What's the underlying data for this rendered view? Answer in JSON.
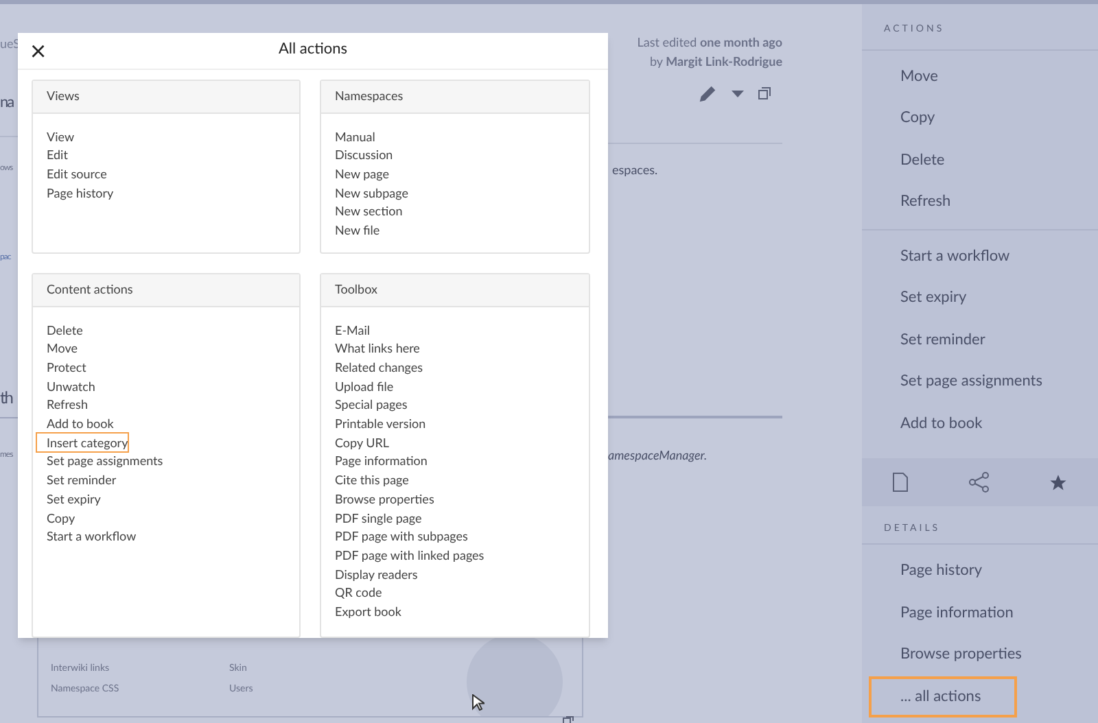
{
  "page": {
    "breadcrumb_fragment": "ueS",
    "title_fragment": "na",
    "text_fragment_1": "ows",
    "link_fragment": "pac",
    "heading_fragment": "th",
    "text_fragment_2": "mes",
    "last_edited": "Last edited **one month ago**",
    "edited_by": "by **Margit Link-Rodrigue**",
    "right_fragment_1": "espaces.",
    "right_fragment_2": "amespaceManager.",
    "table_cells": [
      "Interwiki links",
      "Skin",
      "Namespace CSS",
      "Users"
    ]
  },
  "dialog": {
    "title": "All actions",
    "close": "×",
    "sections": [
      {
        "title": "Views",
        "items": [
          {
            "label": "View",
            "highlighted": false
          },
          {
            "label": "Edit",
            "highlighted": false
          },
          {
            "label": "Edit source",
            "highlighted": false
          },
          {
            "label": "Page history",
            "highlighted": false
          }
        ]
      },
      {
        "title": "Namespaces",
        "items": [
          {
            "label": "Manual",
            "highlighted": false
          },
          {
            "label": "Discussion",
            "highlighted": false
          },
          {
            "label": "New page",
            "highlighted": false
          },
          {
            "label": "New subpage",
            "highlighted": false
          },
          {
            "label": "New section",
            "highlighted": false
          },
          {
            "label": "New file",
            "highlighted": false
          }
        ]
      },
      {
        "title": "Content actions",
        "items": [
          {
            "label": "Delete",
            "highlighted": false
          },
          {
            "label": "Move",
            "highlighted": false
          },
          {
            "label": "Protect",
            "highlighted": false
          },
          {
            "label": "Unwatch",
            "highlighted": false
          },
          {
            "label": "Refresh",
            "highlighted": false
          },
          {
            "label": "Add to book",
            "highlighted": false
          },
          {
            "label": "Insert category",
            "highlighted": true
          },
          {
            "label": "Set page assignments",
            "highlighted": false
          },
          {
            "label": "Set reminder",
            "highlighted": false
          },
          {
            "label": "Set expiry",
            "highlighted": false
          },
          {
            "label": "Copy",
            "highlighted": false
          },
          {
            "label": "Start a workflow",
            "highlighted": false
          }
        ]
      },
      {
        "title": "Toolbox",
        "items": [
          {
            "label": "E-Mail",
            "highlighted": false
          },
          {
            "label": "What links here",
            "highlighted": false
          },
          {
            "label": "Related changes",
            "highlighted": false
          },
          {
            "label": "Upload file",
            "highlighted": false
          },
          {
            "label": "Special pages",
            "highlighted": false
          },
          {
            "label": "Printable version",
            "highlighted": false
          },
          {
            "label": "Copy URL",
            "highlighted": false
          },
          {
            "label": "Page information",
            "highlighted": false
          },
          {
            "label": "Cite this page",
            "highlighted": false
          },
          {
            "label": "Browse properties",
            "highlighted": false
          },
          {
            "label": "PDF single page",
            "highlighted": false
          },
          {
            "label": "PDF page with subpages",
            "highlighted": false
          },
          {
            "label": "PDF page with linked pages",
            "highlighted": false
          },
          {
            "label": "Display readers",
            "highlighted": false
          },
          {
            "label": "QR code",
            "highlighted": false
          },
          {
            "label": "Export book",
            "highlighted": false
          }
        ]
      }
    ]
  },
  "sidebar": {
    "actions_heading": "ACTIONS",
    "action_groups": [
      [
        {
          "label": "Move",
          "highlighted": false
        },
        {
          "label": "Copy",
          "highlighted": false
        },
        {
          "label": "Delete",
          "highlighted": false
        },
        {
          "label": "Refresh",
          "highlighted": false
        }
      ],
      [
        {
          "label": "Start a workflow",
          "highlighted": false
        },
        {
          "label": "Set expiry",
          "highlighted": false
        },
        {
          "label": "Set reminder",
          "highlighted": false
        },
        {
          "label": "Set page assignments",
          "highlighted": false
        },
        {
          "label": "Add to book",
          "highlighted": false
        }
      ]
    ],
    "details_heading": "DETAILS",
    "details": [
      {
        "label": "Page history",
        "highlighted": false
      },
      {
        "label": "Page information",
        "highlighted": false
      },
      {
        "label": "Browse properties",
        "highlighted": false
      },
      {
        "label": "... all actions",
        "highlighted": true
      }
    ]
  }
}
